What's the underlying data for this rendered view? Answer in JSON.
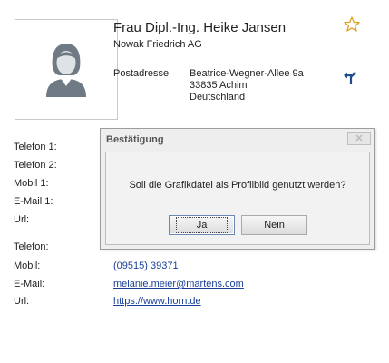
{
  "contact": {
    "name": "Frau Dipl.-Ing. Heike Jansen",
    "company": "Nowak Friedrich AG",
    "address_label": "Postadresse",
    "address_lines": [
      "Beatrice-Wegner-Allee 9a",
      "33835 Achim",
      "Deutschland"
    ]
  },
  "fields_top": [
    {
      "label": "Telefon 1:"
    },
    {
      "label": "Telefon 2:"
    },
    {
      "label": "Mobil 1:"
    },
    {
      "label": "E-Mail 1:"
    },
    {
      "label": "Url:"
    }
  ],
  "fields_bottom": [
    {
      "label": "Telefon:",
      "value": ""
    },
    {
      "label": "Mobil:",
      "value": "(09515) 39371"
    },
    {
      "label": "E-Mail:",
      "value": "melanie.meier@martens.com"
    },
    {
      "label": "Url:",
      "value": "https://www.horn.de"
    }
  ],
  "dialog": {
    "title": "Bestätigung",
    "message": "Soll die Grafikdatei als Profilbild genutzt werden?",
    "yes_label": "Ja",
    "no_label": "Nein"
  },
  "icons": {
    "avatar": "person-avatar-icon",
    "favorite": "star-icon",
    "route": "route-arrow-icon",
    "close": "close-icon"
  },
  "colors": {
    "link": "#1a3f99",
    "star": "#e0a020",
    "route": "#1f4e8c",
    "avatar": "#6f7a84"
  }
}
